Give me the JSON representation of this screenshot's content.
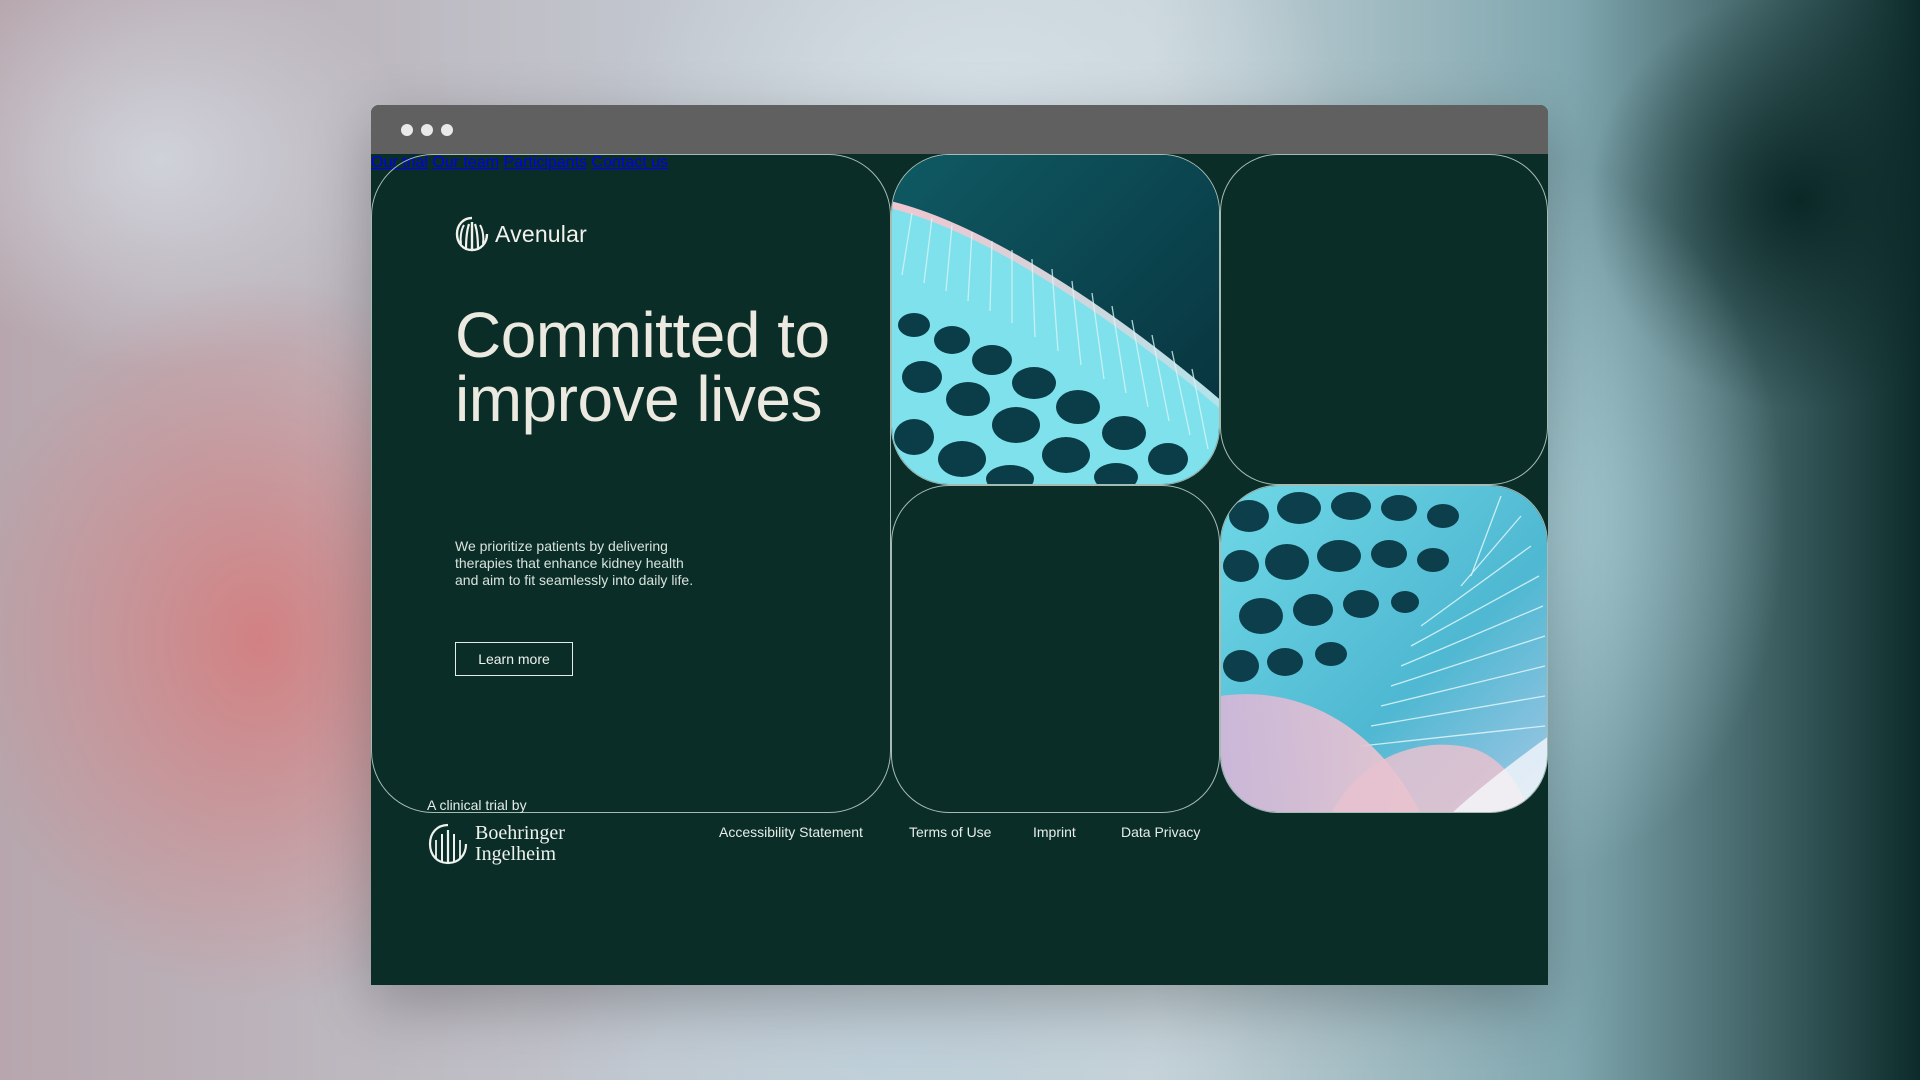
{
  "brand": {
    "name": "Avenular",
    "icon": "avenular-logo-icon"
  },
  "nav": {
    "items": [
      {
        "label": "Our trial"
      },
      {
        "label": "Our team"
      },
      {
        "label": "Participants"
      },
      {
        "label": "Contact us"
      }
    ]
  },
  "hero": {
    "headline": "Committed to improve lives",
    "intro": "We prioritize patients by delivering therapies that enhance kidney health and aim to fit seamlessly into daily life.",
    "cta_label": "Learn more"
  },
  "footer": {
    "sponsor_label": "A clinical trial by",
    "sponsor_name_line1": "Boehringer",
    "sponsor_name_line2": "Ingelheim",
    "links": [
      {
        "label": "Accessibility Statement"
      },
      {
        "label": "Terms of Use"
      },
      {
        "label": "Imprint"
      },
      {
        "label": "Data Privacy"
      }
    ]
  },
  "colors": {
    "page_background": "#0a2e27",
    "titlebar": "#606060",
    "text_light": "#ebe9e0",
    "tile_accent": "#7fe1ec"
  }
}
